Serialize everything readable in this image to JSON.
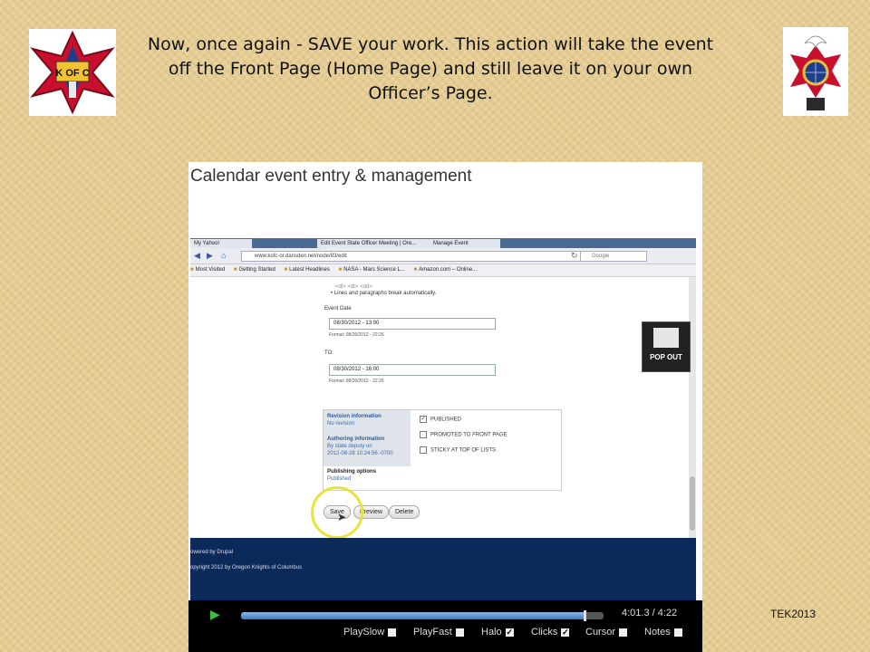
{
  "slide": {
    "title": "Now, once again - SAVE your work. This action will take the event off the Front Page (Home Page) and still leave it on your own Officer’s Page.",
    "footer_tag": "TEK2013",
    "left_logo_text": "K OF C"
  },
  "video": {
    "heading": "Calendar event entry & management",
    "popout_label": "POP OUT",
    "time": "4:01.3 / 4:22",
    "progress_fraction": 0.95,
    "controls": [
      {
        "label": "PlaySlow",
        "checked": false
      },
      {
        "label": "PlayFast",
        "checked": false
      },
      {
        "label": "Halo",
        "checked": true
      },
      {
        "label": "Clicks",
        "checked": true
      },
      {
        "label": "Cursor",
        "checked": false
      },
      {
        "label": "Notes",
        "checked": false
      }
    ]
  },
  "browser": {
    "tabs": [
      "My Yahoo!",
      "Edit Event State Officer Meeting | Ore...",
      "Manage Event"
    ],
    "url": "www.kofc-or.dansden.net/node/83/edit",
    "search_placeholder": "Google",
    "bookmarks": [
      "Most Visited",
      "Getting Started",
      "Latest Headlines",
      "NASA - Mars Science L...",
      "Amazon.com – Online..."
    ]
  },
  "page": {
    "tips_partial": "Lines and paragraphs break automatically.",
    "tips_tags": "<dl> <dt> <dd>",
    "event_date_label": "Event Date",
    "event_date_value": "08/30/2012 - 13:00",
    "format_1": "Format: 08/26/2012 - 22:26",
    "to_label": "TO:",
    "to_value": "08/30/2012 - 16:00",
    "format_2": "Format: 08/26/2012 - 22:26",
    "revision_title": "Revision information",
    "revision_sub": "No revision",
    "authoring_title": "Authoring information",
    "authoring_sub1": "By state deputy on",
    "authoring_sub2": "2012-08-28 10:24:56 -0700",
    "publishing_title": "Publishing options",
    "publishing_sub": "Published",
    "opt_published": "PUBLISHED",
    "opt_promoted": "PROMOTED TO FRONT PAGE",
    "opt_sticky": "STICKY AT TOP OF LISTS",
    "btn_save": "Save",
    "btn_preview": "Preview",
    "btn_delete": "Delete",
    "footer_powered": "owered by Drupal",
    "footer_copyright": "opyright 2012 by Oregon Knights of Columbus"
  }
}
